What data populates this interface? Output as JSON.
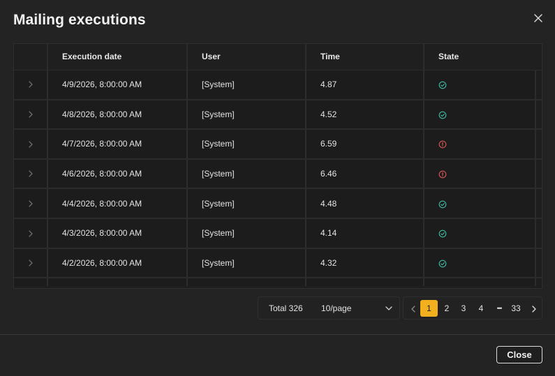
{
  "dialog": {
    "title": "Mailing executions",
    "close_icon": "close-icon"
  },
  "table": {
    "columns": [
      {
        "label": ""
      },
      {
        "label": "Execution date"
      },
      {
        "label": "User"
      },
      {
        "label": "Time"
      },
      {
        "label": "State"
      }
    ],
    "rows": [
      {
        "date": "4/9/2026, 8:00:00 AM",
        "user": "[System]",
        "time": "4.87",
        "state": "success"
      },
      {
        "date": "4/8/2026, 8:00:00 AM",
        "user": "[System]",
        "time": "4.52",
        "state": "success"
      },
      {
        "date": "4/7/2026, 8:00:00 AM",
        "user": "[System]",
        "time": "6.59",
        "state": "error"
      },
      {
        "date": "4/6/2026, 8:00:00 AM",
        "user": "[System]",
        "time": "6.46",
        "state": "error"
      },
      {
        "date": "4/4/2026, 8:00:00 AM",
        "user": "[System]",
        "time": "4.48",
        "state": "success"
      },
      {
        "date": "4/3/2026, 8:00:00 AM",
        "user": "[System]",
        "time": "4.14",
        "state": "success"
      },
      {
        "date": "4/2/2026, 8:00:00 AM",
        "user": "[System]",
        "time": "4.32",
        "state": "success"
      }
    ],
    "state_colors": {
      "success": "#3fc0a4",
      "error": "#e05757"
    }
  },
  "pagination": {
    "total_label": "Total 326",
    "page_size": "10/page",
    "pages": [
      "1",
      "2",
      "3",
      "4"
    ],
    "ellipsis": "•••",
    "last_page": "33",
    "current_page": "1",
    "accent": "#f2b01e"
  },
  "footer": {
    "close_label": "Close"
  }
}
